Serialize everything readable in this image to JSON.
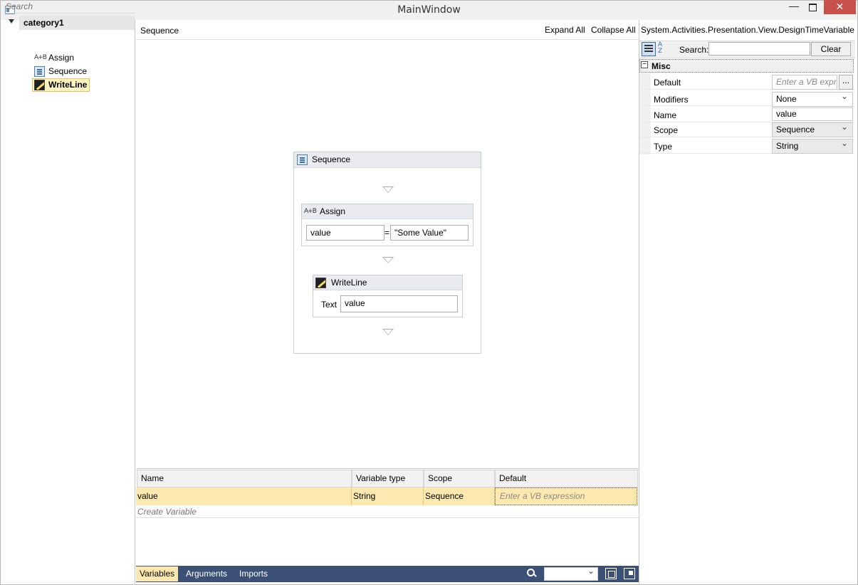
{
  "window": {
    "title": "MainWindow",
    "minimize": "—",
    "close": "✕"
  },
  "toolbox": {
    "search_placeholder": "Search",
    "category": "category1",
    "items": [
      {
        "label": "Assign",
        "icon": "assign-icon"
      },
      {
        "label": "Sequence",
        "icon": "sequence-icon"
      },
      {
        "label": "WriteLine",
        "icon": "writeline-icon",
        "selected": true
      }
    ]
  },
  "designer": {
    "breadcrumb": "Sequence",
    "expand_all": "Expand All",
    "collapse_all": "Collapse All",
    "sequence": {
      "title": "Sequence",
      "assign": {
        "title": "Assign",
        "to": "value",
        "equals": "=",
        "value": "\"Some Value\"",
        "icon_text": "A+B"
      },
      "writeline": {
        "title": "WriteLine",
        "text_label": "Text",
        "text": "value"
      }
    }
  },
  "variables": {
    "headers": [
      "Name",
      "Variable type",
      "Scope",
      "Default"
    ],
    "rows": [
      {
        "name": "value",
        "type": "String",
        "scope": "Sequence",
        "default": "Enter a VB expression"
      }
    ],
    "create": "Create Variable",
    "tabs": [
      "Variables",
      "Arguments",
      "Imports"
    ]
  },
  "properties": {
    "title": "System.Activities.Presentation.View.DesignTimeVariable",
    "search_label": "Search:",
    "search_value": "",
    "clear": "Clear",
    "sort_icon_text": "A\nZ",
    "category": "Misc",
    "toggle": "−",
    "rows": [
      {
        "name": "Default",
        "value": "Enter a VB expression",
        "ellipsis": "..."
      },
      {
        "name": "Modifiers",
        "value": "None"
      },
      {
        "name": "Name",
        "value": "value"
      },
      {
        "name": "Scope",
        "value": "Sequence"
      },
      {
        "name": "Type",
        "value": "String"
      }
    ]
  },
  "colors": {
    "selection": "#fde8b0",
    "bottom_bar": "#3c4f74",
    "close_button": "#c7504a"
  }
}
